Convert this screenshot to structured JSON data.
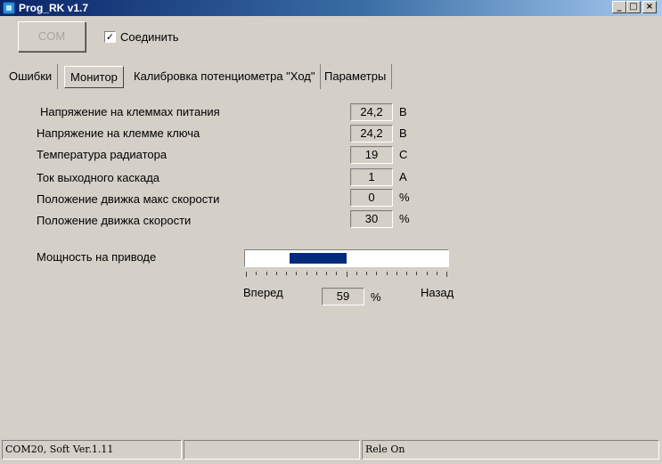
{
  "window": {
    "title": "Prog_RK v1.7",
    "controls": {
      "minimize": "_",
      "maximize": "□",
      "close": "×"
    }
  },
  "toolbar": {
    "com_label": "COM",
    "connect_label": "Соединить",
    "connect_checked": true,
    "check_mark": "✓"
  },
  "tabs": [
    {
      "label": "Ошибки",
      "active": false
    },
    {
      "label": "Монитор",
      "active": true
    },
    {
      "label": "Калибровка потенциометра \"Ход\"",
      "active": false
    },
    {
      "label": "Параметры",
      "active": false
    }
  ],
  "monitor": {
    "rows": [
      {
        "label": "Напряжение на клеммах питания",
        "value": "24,2",
        "unit": "В"
      },
      {
        "label": "Напряжение на клемме ключа",
        "value": "24,2",
        "unit": "В"
      },
      {
        "label": "Температура радиатора",
        "value": "19",
        "unit": "С"
      },
      {
        "label": "Ток выходного каскада",
        "value": "1",
        "unit": "А"
      },
      {
        "label": "Положение движка макс скорости",
        "value": "0",
        "unit": "%"
      },
      {
        "label": "Положение движка скорости",
        "value": "30",
        "unit": "%"
      }
    ],
    "power": {
      "label": "Мощность на приводе",
      "forward_label": "Вперед",
      "backward_label": "Назад",
      "value": "59",
      "unit": "%",
      "bar_start_fraction": 0.22,
      "bar_end_fraction": 0.5
    }
  },
  "status": {
    "panels": [
      "COM20, Soft Ver.1.11",
      "",
      "Rele On"
    ]
  },
  "colors": {
    "titlebar_start": "#0a246a",
    "titlebar_end": "#a6caf0",
    "window_bg": "#d4d0c8",
    "gauge_fill": "#002a7a"
  }
}
